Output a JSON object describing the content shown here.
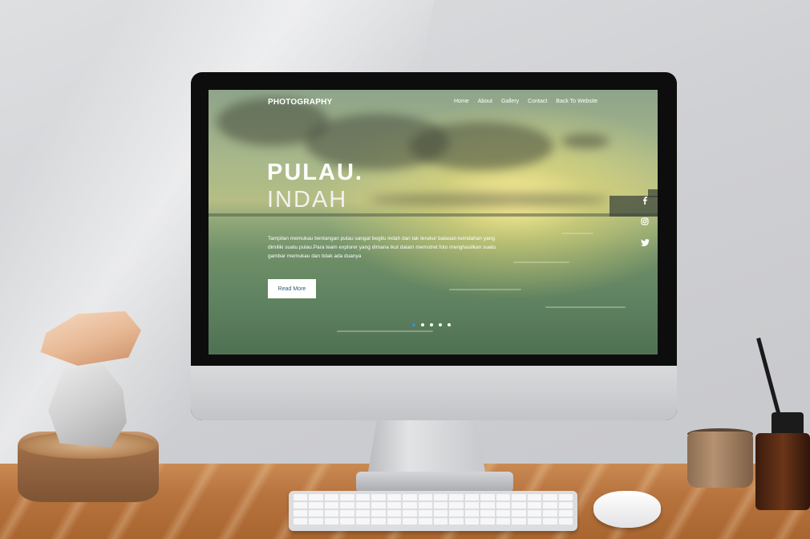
{
  "site": {
    "brand": "PHOTOGRAPHY",
    "nav": [
      "Home",
      "About",
      "Gallery",
      "Contact",
      "Back To Website"
    ],
    "hero": {
      "title": "PULAU.",
      "subtitle": "INDAH",
      "description": "Tampilan memukau bentangan pulau sangat begitu indah dan tak terukur batasan keindahan yang dimiliki suatu pulau.Para team explorer yang dimana ikut dalam memotret foto menghasilkan suatu gambar memukau dan tidak ada duanya",
      "button_label": "Read More"
    },
    "social": [
      "facebook-icon",
      "instagram-icon",
      "twitter-icon"
    ],
    "slider": {
      "count": 5,
      "active_index": 0
    }
  },
  "colors": {
    "accent_dot": "#3c8fd0",
    "button_text": "#2f5d7a"
  }
}
